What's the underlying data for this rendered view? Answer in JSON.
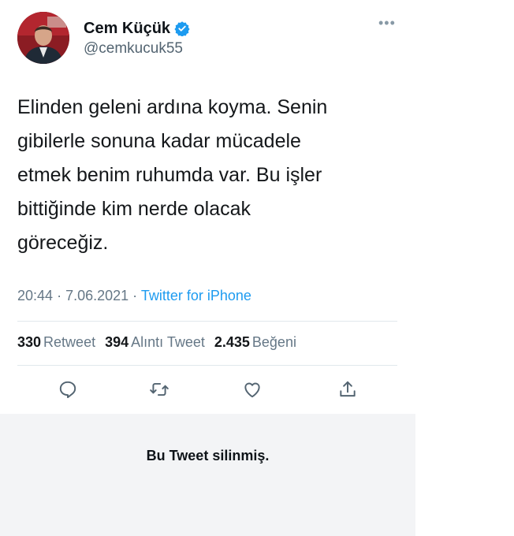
{
  "author": {
    "display_name": "Cem Küçük",
    "handle": "@cemkucuk55",
    "verified_icon": "verified-badge-icon",
    "avatar": "profile-photo"
  },
  "more_icon": "more-horizontal-icon",
  "tweet": {
    "text": "Elinden geleni ardına koyma. Senin\ngibilerle sonuna kadar mücadele\netmek benim ruhumda var. Bu işler\nbittiğinde kim nerde olacak\ngöreceğiz."
  },
  "meta": {
    "time": "20:44",
    "sep1": "·",
    "date": "7.06.2021",
    "sep2": "·",
    "source": "Twitter for iPhone"
  },
  "stats": {
    "retweets_count": "330",
    "retweets_label": "Retweet",
    "quotes_count": "394",
    "quotes_label": "Alıntı Tweet",
    "likes_count": "2.435",
    "likes_label": "Beğeni"
  },
  "actions": [
    "reply-icon",
    "retweet-icon",
    "like-icon",
    "share-icon"
  ],
  "deleted_notice": "Bu Tweet silinmiş.",
  "colors": {
    "link_blue": "#1d9bf0",
    "secondary_text": "#657786",
    "icon_gray": "#536471",
    "panel_bg": "#f3f4f6"
  }
}
